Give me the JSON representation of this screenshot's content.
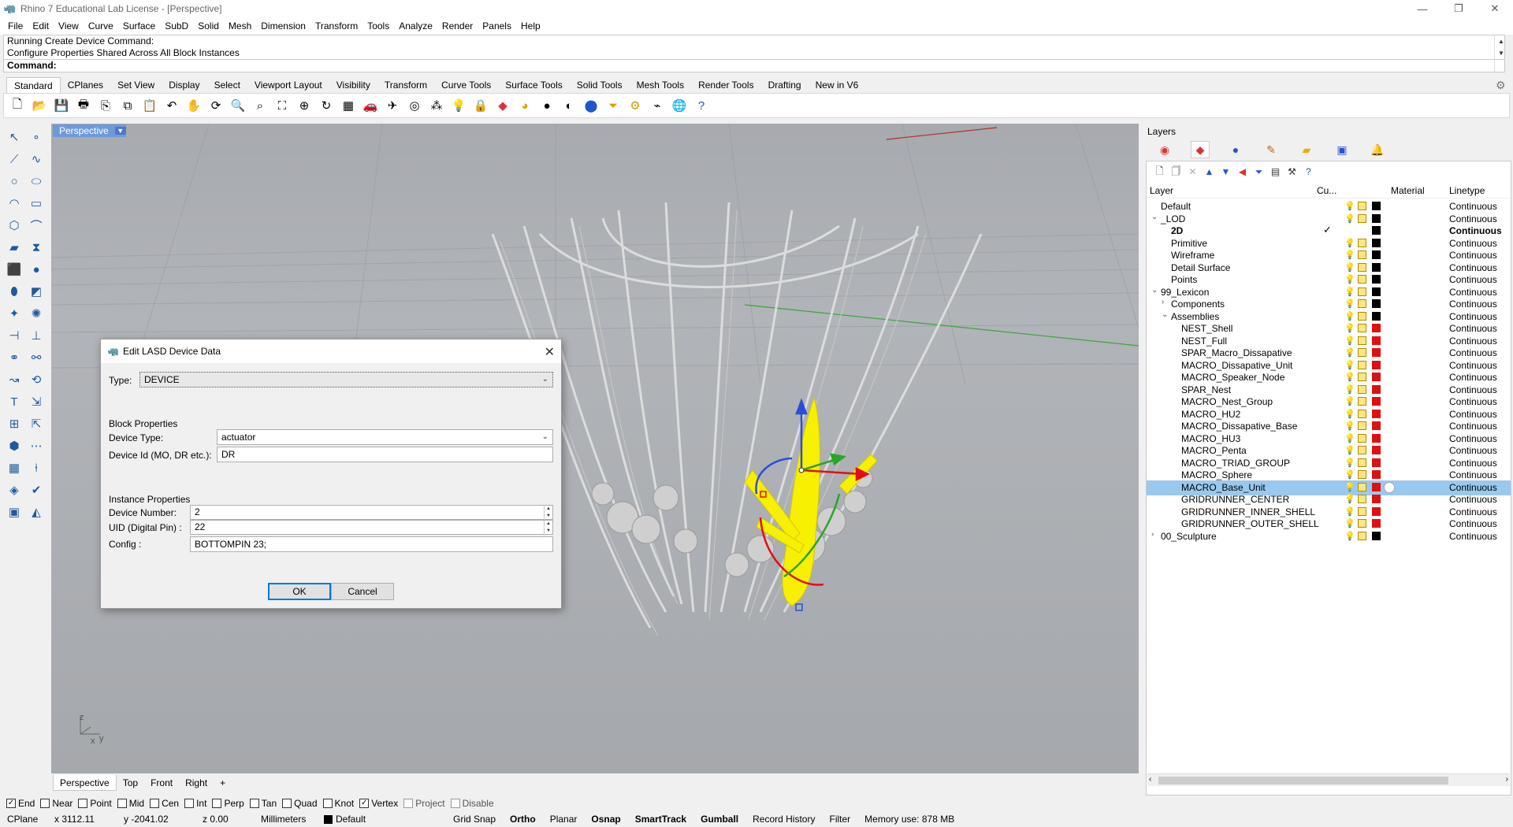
{
  "window": {
    "title": "Rhino 7 Educational Lab License - [Perspective]",
    "app_icon": "rhino-icon",
    "controls": [
      "—",
      "❐",
      "✕"
    ]
  },
  "menu": [
    "File",
    "Edit",
    "View",
    "Curve",
    "Surface",
    "SubD",
    "Solid",
    "Mesh",
    "Dimension",
    "Transform",
    "Tools",
    "Analyze",
    "Render",
    "Panels",
    "Help"
  ],
  "command": {
    "history": [
      "Running Create Device Command:",
      "Configure Properties Shared Across All Block Instances"
    ],
    "prompt": "Command:"
  },
  "toolbar_tabs": [
    "Standard",
    "CPlanes",
    "Set View",
    "Display",
    "Select",
    "Viewport Layout",
    "Visibility",
    "Transform",
    "Curve Tools",
    "Surface Tools",
    "Solid Tools",
    "Mesh Tools",
    "Render Tools",
    "Drafting",
    "New in V6"
  ],
  "toolbar_icons": [
    "new-icon",
    "open-icon",
    "save-icon",
    "print-icon",
    "import-icon",
    "copy-icon",
    "paste-icon",
    "undo-icon",
    "pan-icon",
    "rotate-icon",
    "zoom-icon",
    "zoom-window-icon",
    "zoom-extents-icon",
    "zoom-selected-icon",
    "rotate-view-icon",
    "four-views-icon",
    "car-icon",
    "plane-icon",
    "target-icon",
    "points-icon",
    "light-icon",
    "lock-icon",
    "layer-icon",
    "color-icon",
    "sphere-icon",
    "sphere-shaded-icon",
    "render-sphere-icon",
    "funnel-icon",
    "gear-icon",
    "curve-tools-icon",
    "globe-icon",
    "help-icon"
  ],
  "viewport": {
    "title": "Perspective",
    "axes": {
      "z": "z",
      "x": "x",
      "y": "y"
    }
  },
  "viewport_tabs": [
    "Perspective",
    "Top",
    "Front",
    "Right",
    "+"
  ],
  "osnaps": [
    {
      "label": "End",
      "checked": true
    },
    {
      "label": "Near",
      "checked": false
    },
    {
      "label": "Point",
      "checked": false
    },
    {
      "label": "Mid",
      "checked": false
    },
    {
      "label": "Cen",
      "checked": false
    },
    {
      "label": "Int",
      "checked": false
    },
    {
      "label": "Perp",
      "checked": false
    },
    {
      "label": "Tan",
      "checked": false
    },
    {
      "label": "Quad",
      "checked": false
    },
    {
      "label": "Knot",
      "checked": false
    },
    {
      "label": "Vertex",
      "checked": true
    },
    {
      "label": "Project",
      "checked": false,
      "disabled": true
    },
    {
      "label": "Disable",
      "checked": false,
      "disabled": true
    }
  ],
  "status": {
    "cplane": "CPlane",
    "x": "x 3112.11",
    "y": "y -2041.02",
    "z": "z 0.00",
    "units": "Millimeters",
    "layer": "Default",
    "grid_snap": "Grid Snap",
    "ortho": "Ortho",
    "planar": "Planar",
    "osnap": "Osnap",
    "smarttrack": "SmartTrack",
    "gumball": "Gumball",
    "record_history": "Record History",
    "filter": "Filter",
    "memory": "Memory use: 878 MB"
  },
  "layers": {
    "title": "Layers",
    "columns": {
      "layer": "Layer",
      "current": "Cu...",
      "material": "Material",
      "linetype": "Linetype"
    },
    "rows": [
      {
        "name": "Default",
        "indent": 0,
        "arrow": "",
        "bulb": "on",
        "color": "#000000",
        "linetype": "Continuous"
      },
      {
        "name": "_LOD",
        "indent": 0,
        "arrow": "⌄",
        "bulb": "on",
        "color": "#000000",
        "linetype": "Continuous"
      },
      {
        "name": "2D",
        "indent": 1,
        "arrow": "",
        "bulb": "none",
        "color": "#000000",
        "linetype": "Continuous",
        "current": true
      },
      {
        "name": "Primitive",
        "indent": 1,
        "arrow": "",
        "bulb": "off",
        "color": "#000000",
        "linetype": "Continuous"
      },
      {
        "name": "Wireframe",
        "indent": 1,
        "arrow": "",
        "bulb": "off",
        "color": "#000000",
        "linetype": "Continuous"
      },
      {
        "name": "Detail Surface",
        "indent": 1,
        "arrow": "",
        "bulb": "on",
        "color": "#000000",
        "linetype": "Continuous"
      },
      {
        "name": "Points",
        "indent": 1,
        "arrow": "",
        "bulb": "on",
        "color": "#000000",
        "linetype": "Continuous"
      },
      {
        "name": "99_Lexicon",
        "indent": 0,
        "arrow": "⌄",
        "bulb": "on",
        "color": "#000000",
        "linetype": "Continuous"
      },
      {
        "name": "Components",
        "indent": 1,
        "arrow": "›",
        "bulb": "on",
        "color": "#000000",
        "linetype": "Continuous"
      },
      {
        "name": "Assemblies",
        "indent": 1,
        "arrow": "⌄",
        "bulb": "on",
        "color": "#000000",
        "linetype": "Continuous"
      },
      {
        "name": "NEST_Shell",
        "indent": 2,
        "arrow": "",
        "bulb": "off",
        "color": "#e01010",
        "linetype": "Continuous"
      },
      {
        "name": "NEST_Full",
        "indent": 2,
        "arrow": "",
        "bulb": "off",
        "color": "#e01010",
        "linetype": "Continuous"
      },
      {
        "name": "SPAR_Macro_Dissapative",
        "indent": 2,
        "arrow": "",
        "bulb": "on",
        "color": "#e01010",
        "linetype": "Continuous"
      },
      {
        "name": "MACRO_Dissapative_Unit",
        "indent": 2,
        "arrow": "",
        "bulb": "off",
        "color": "#e01010",
        "linetype": "Continuous"
      },
      {
        "name": "MACRO_Speaker_Node",
        "indent": 2,
        "arrow": "",
        "bulb": "off",
        "color": "#e01010",
        "linetype": "Continuous"
      },
      {
        "name": "SPAR_Nest",
        "indent": 2,
        "arrow": "",
        "bulb": "off",
        "color": "#e01010",
        "linetype": "Continuous"
      },
      {
        "name": "MACRO_Nest_Group",
        "indent": 2,
        "arrow": "",
        "bulb": "off",
        "color": "#e01010",
        "linetype": "Continuous"
      },
      {
        "name": "MACRO_HU2",
        "indent": 2,
        "arrow": "",
        "bulb": "off",
        "color": "#e01010",
        "linetype": "Continuous"
      },
      {
        "name": "MACRO_Dissapative_Base",
        "indent": 2,
        "arrow": "",
        "bulb": "off",
        "color": "#e01010",
        "linetype": "Continuous"
      },
      {
        "name": "MACRO_HU3",
        "indent": 2,
        "arrow": "",
        "bulb": "off",
        "color": "#e01010",
        "linetype": "Continuous"
      },
      {
        "name": "MACRO_Penta",
        "indent": 2,
        "arrow": "",
        "bulb": "off",
        "color": "#e01010",
        "linetype": "Continuous"
      },
      {
        "name": "MACRO_TRIAD_GROUP",
        "indent": 2,
        "arrow": "",
        "bulb": "off",
        "color": "#e01010",
        "linetype": "Continuous"
      },
      {
        "name": "MACRO_Sphere",
        "indent": 2,
        "arrow": "",
        "bulb": "off",
        "color": "#e01010",
        "linetype": "Continuous"
      },
      {
        "name": "MACRO_Base_Unit",
        "indent": 2,
        "arrow": "",
        "bulb": "on",
        "color": "#e01010",
        "linetype": "Continuous",
        "selected": true
      },
      {
        "name": "GRIDRUNNER_CENTER",
        "indent": 2,
        "arrow": "",
        "bulb": "off",
        "color": "#e01010",
        "linetype": "Continuous"
      },
      {
        "name": "GRIDRUNNER_INNER_SHELL",
        "indent": 2,
        "arrow": "",
        "bulb": "off",
        "color": "#e01010",
        "linetype": "Continuous"
      },
      {
        "name": "GRIDRUNNER_OUTER_SHELL",
        "indent": 2,
        "arrow": "",
        "bulb": "off",
        "color": "#e01010",
        "linetype": "Continuous"
      },
      {
        "name": "00_Sculpture",
        "indent": 0,
        "arrow": "›",
        "bulb": "off",
        "color": "#000000",
        "linetype": "Continuous"
      }
    ]
  },
  "dialog": {
    "title": "Edit LASD Device Data",
    "close": "✕",
    "type_label": "Type:",
    "type_value": "DEVICE",
    "block_heading": "Block Properties",
    "device_type_label": "Device Type:",
    "device_type_value": "actuator",
    "device_id_label": "Device Id (MO, DR etc.):",
    "device_id_value": "DR",
    "instance_heading": "Instance Properties",
    "device_number_label": "Device Number:",
    "device_number_value": "2",
    "uid_label": "UID (Digital Pin) :",
    "uid_value": "22",
    "config_label": "Config :",
    "config_value": "BOTTOMPIN 23;",
    "ok": "OK",
    "cancel": "Cancel"
  }
}
